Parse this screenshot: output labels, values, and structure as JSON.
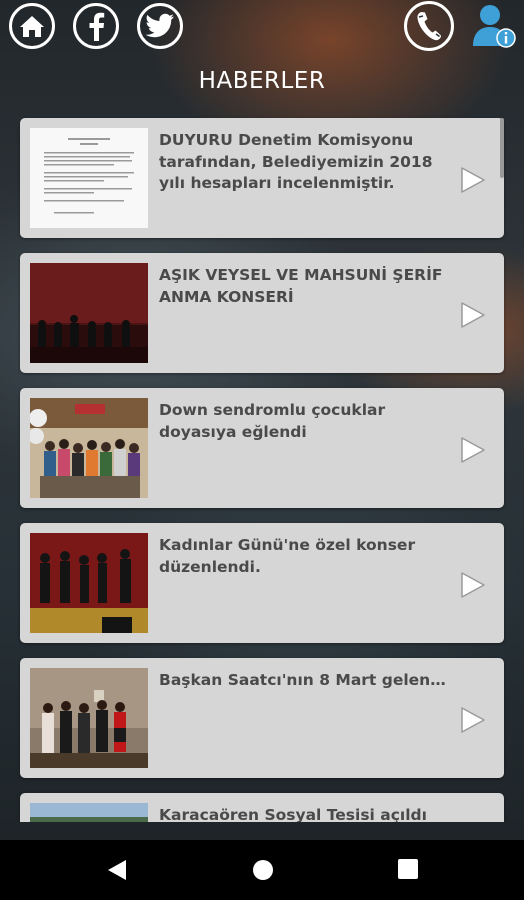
{
  "header": {
    "title": "HABERLER",
    "home_icon": "home-icon",
    "facebook_icon": "facebook-icon",
    "twitter_icon": "twitter-icon",
    "phone_icon": "phone-icon",
    "user_info_icon": "user-info-icon"
  },
  "colors": {
    "card_bg": "#d6d6d6",
    "card_text": "#4a4a4a",
    "accent_blue": "#3fa0d8"
  },
  "news": [
    {
      "title": "DUYURU Denetim Komisyonu tarafından, Belediyemizin 2018 yılı hesapları incelenmiştir.",
      "thumb": "document"
    },
    {
      "title": "AŞIK VEYSEL VE MAHSUNİ ŞERİF ANMA KONSERİ",
      "thumb": "concert"
    },
    {
      "title": "Down sendromlu çocuklar doyasıya eğlendi",
      "thumb": "group"
    },
    {
      "title": "Kadınlar Günü'ne özel konser düzenlendi.",
      "thumb": "stage"
    },
    {
      "title": "Başkan Saatcı'nın 8 Mart geleneği...",
      "thumb": "women"
    },
    {
      "title": "Karacaören Sosyal Tesisi açıldı",
      "thumb": "outdoor"
    }
  ],
  "navbar": {
    "back_icon": "back-icon",
    "home_icon": "home-circle-icon",
    "recents_icon": "recents-icon"
  }
}
